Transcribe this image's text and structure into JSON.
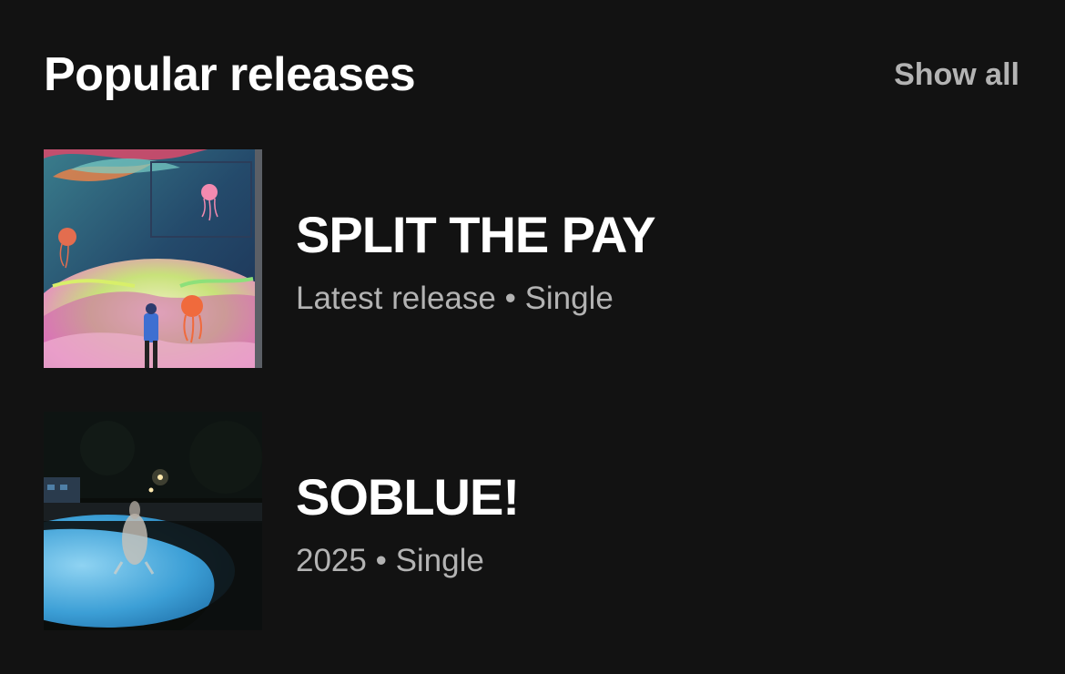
{
  "section": {
    "title": "Popular releases",
    "show_all_label": "Show all"
  },
  "releases": [
    {
      "title": "SPLIT THE PAY",
      "subtitle": "Latest release • Single",
      "cover": "mural-artwork-cover"
    },
    {
      "title": "SOBLUE!",
      "subtitle": "2025 • Single",
      "cover": "night-pool-cover"
    }
  ],
  "colors": {
    "background": "#121212",
    "primary_text": "#ffffff",
    "secondary_text": "#b3b3b3"
  }
}
